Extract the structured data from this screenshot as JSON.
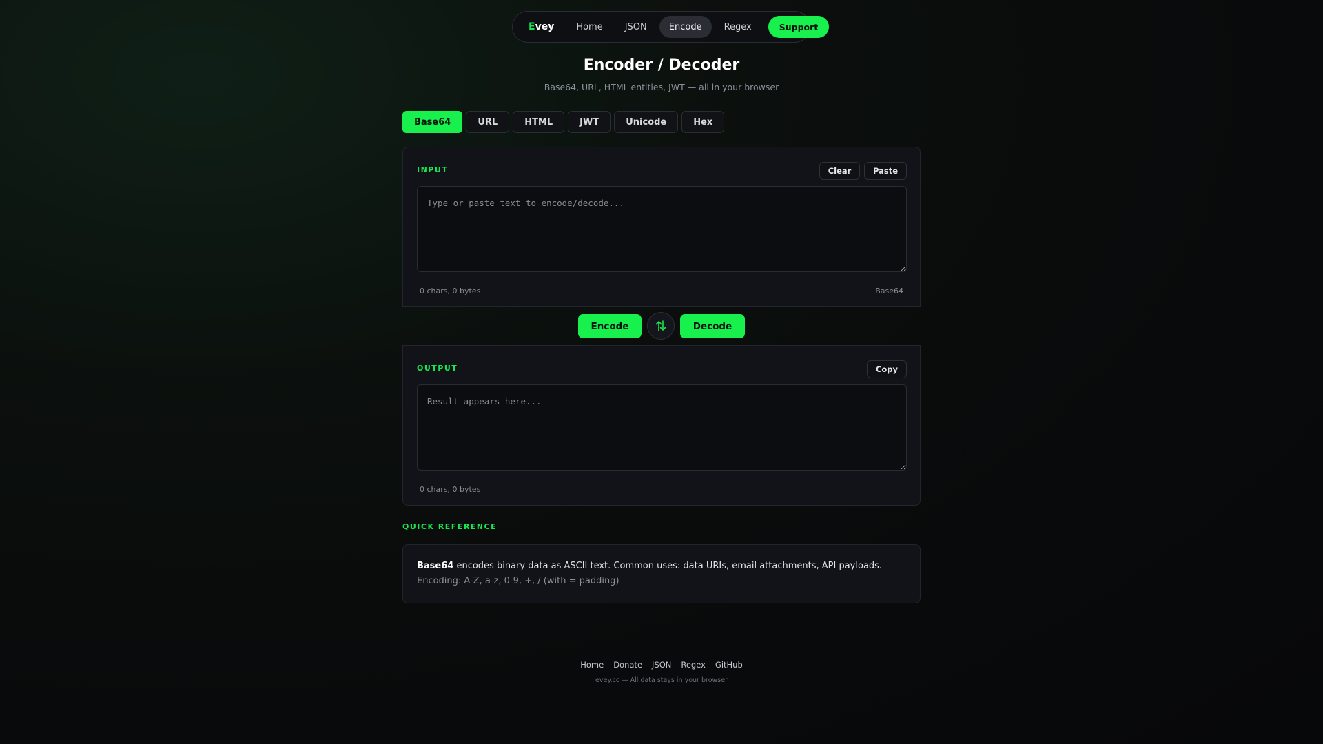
{
  "nav": {
    "brand_first": "E",
    "brand_rest": "vey",
    "items": [
      {
        "label": "Home"
      },
      {
        "label": "JSON"
      },
      {
        "label": "Encode"
      },
      {
        "label": "Regex"
      }
    ],
    "active": "Encode",
    "support_label": "Support"
  },
  "header": {
    "title": "Encoder / Decoder",
    "subtitle": "Base64, URL, HTML entities, JWT — all in your browser"
  },
  "tabs": [
    {
      "label": "Base64"
    },
    {
      "label": "URL"
    },
    {
      "label": "HTML"
    },
    {
      "label": "JWT"
    },
    {
      "label": "Unicode"
    },
    {
      "label": "Hex"
    }
  ],
  "active_tab": "Base64",
  "input": {
    "label": "INPUT",
    "clear_label": "Clear",
    "paste_label": "Paste",
    "value": "",
    "placeholder": "Type or paste text to encode/decode...",
    "stats": "0 chars, 0 bytes",
    "mode": "Base64"
  },
  "actions": {
    "encode_label": "Encode",
    "swap_icon": "swap-vertical-icon",
    "decode_label": "Decode"
  },
  "output": {
    "label": "OUTPUT",
    "copy_label": "Copy",
    "value": "",
    "placeholder": "Result appears here...",
    "stats": "0 chars, 0 bytes"
  },
  "reference": {
    "heading": "QUICK REFERENCE",
    "term": "Base64",
    "description": " encodes binary data as ASCII text. Common uses: data URIs, email attachments, API payloads.",
    "encoding_note": "Encoding: A-Z, a-z, 0-9, +, / (with = padding)"
  },
  "footer": {
    "links": [
      {
        "label": "Home"
      },
      {
        "label": "Donate"
      },
      {
        "label": "JSON"
      },
      {
        "label": "Regex"
      },
      {
        "label": "GitHub"
      }
    ],
    "note": "evey.cc — All data stays in your browser"
  },
  "colors": {
    "accent": "#18f04e",
    "background": "#090a0b",
    "panel": "#111319"
  }
}
